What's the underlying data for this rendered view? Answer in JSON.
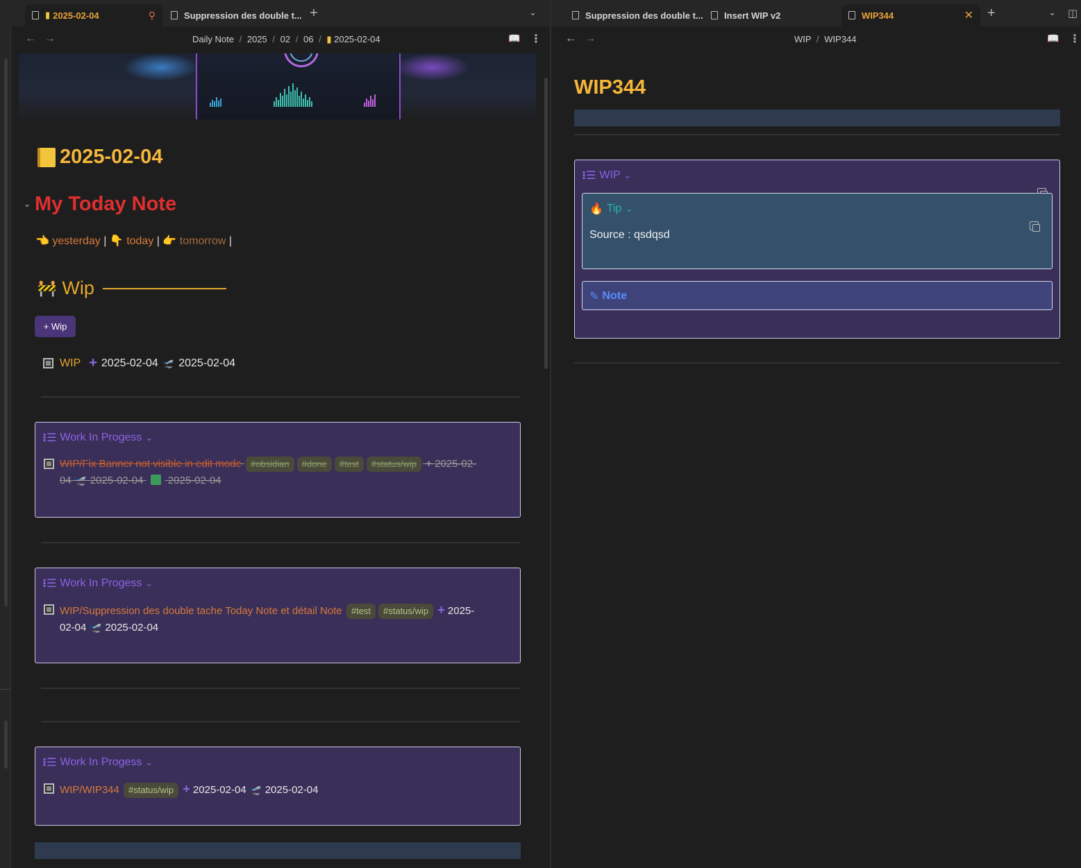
{
  "tabs_left": [
    {
      "label": "2025-02-04",
      "active": true,
      "pinned": true
    },
    {
      "label": "Suppression des double t...",
      "active": false
    }
  ],
  "tabs_right": [
    {
      "label": "Suppression des double t...",
      "active": false
    },
    {
      "label": "Insert WIP v2",
      "active": false
    },
    {
      "label": "WIP344",
      "active": true
    }
  ],
  "left_pane": {
    "breadcrumb": [
      "Daily Note",
      "2025",
      "02",
      "06",
      "2025-02-04"
    ],
    "title": "2025-02-04",
    "heading": "My Today Note",
    "nav": {
      "yesterday": "yesterday",
      "today": "today",
      "tomorrow": "tomorrow",
      "sep": "|"
    },
    "wip_heading": "Wip",
    "wip_button": "+ Wip",
    "task": {
      "link": "WIP",
      "created": "2025-02-04",
      "start": "2025-02-04"
    },
    "callouts": [
      {
        "title": "Work In Progess",
        "task": {
          "done": true,
          "link": "WIP/Fix Banner not visible in edit mode",
          "tags": [
            "#obsidian",
            "#done",
            "#test",
            "#status/wip"
          ],
          "line1_tail": "2025-02-",
          "line2_head": "04",
          "start": "2025-02-04",
          "completed": "2025-02-04"
        }
      },
      {
        "title": "Work In Progess",
        "task": {
          "done": false,
          "link": "WIP/Suppression des double tache Today Note et détail Note",
          "tags": [
            "#test",
            "#status/wip"
          ],
          "line1_tail": "2025-",
          "line2_head": "02-04",
          "start": "2025-02-04"
        }
      },
      {
        "title": "Work In Progess",
        "task": {
          "done": false,
          "link": "WIP/WIP344",
          "tags": [
            "#status/wip"
          ],
          "created": "2025-02-04",
          "start": "2025-02-04"
        }
      }
    ]
  },
  "right_pane": {
    "breadcrumb": [
      "WIP",
      "WIP344"
    ],
    "title": "WIP344",
    "callout_title": "WIP",
    "tip_title": "Tip",
    "tip_body": "Source : qsdqsd",
    "note_title": "Note"
  },
  "colors": {
    "accent": "#e6a72c",
    "heading_red": "#e02f2f",
    "callout_bg": "#3a2f58",
    "callout_title": "#8c63e6",
    "tip_bg": "#34506a",
    "tip_title": "#27b6a6",
    "note_bg": "#3e437a",
    "note_title": "#5a8cff"
  }
}
